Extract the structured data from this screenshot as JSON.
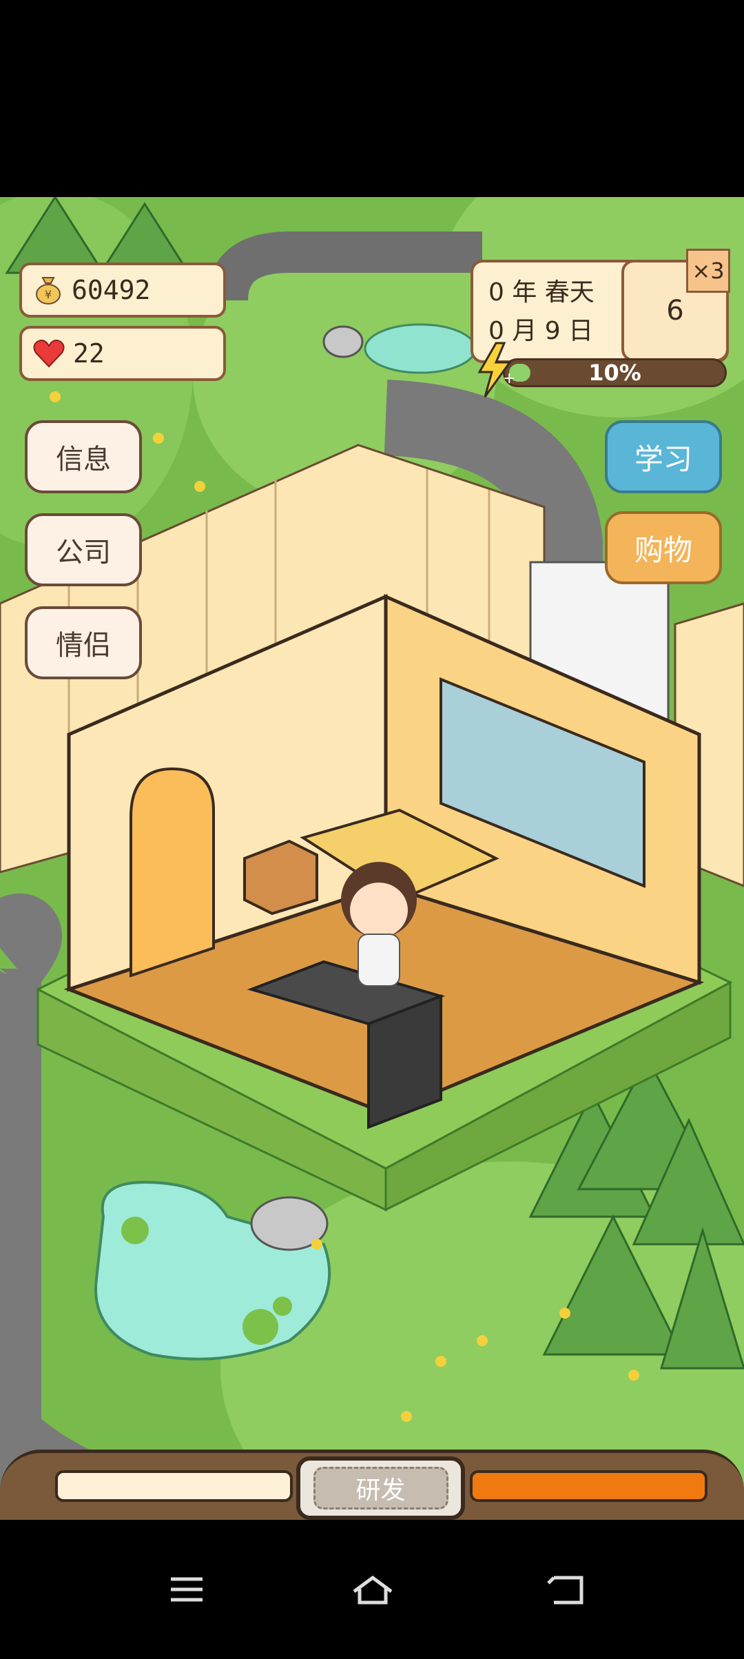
{
  "hud": {
    "money": "60492",
    "hearts": "22",
    "year_line": "0 年 春天",
    "date_line": "0 月 9 日",
    "day_box": "6",
    "multiplier": "×3",
    "energy_percent": "10%",
    "energy_fraction": 0.1
  },
  "left_buttons": {
    "info": "信息",
    "company": "公司",
    "couple": "情侣"
  },
  "right_buttons": {
    "study": "学习",
    "shop": "购物"
  },
  "bottom_bar": {
    "center_label": "研发"
  },
  "colors": {
    "grass": "#76b94a",
    "road": "#7f7f7f",
    "study_button": "#5ab6d6",
    "shop_button": "#f4b45a",
    "energy_fill": "#8fd16a",
    "progress_orange": "#f07a10"
  },
  "icons": {
    "money": "money-bag-icon",
    "heart": "heart-icon",
    "energy": "lightning-icon",
    "nav_menu": "menu-icon",
    "nav_home": "home-icon",
    "nav_back": "back-icon"
  }
}
